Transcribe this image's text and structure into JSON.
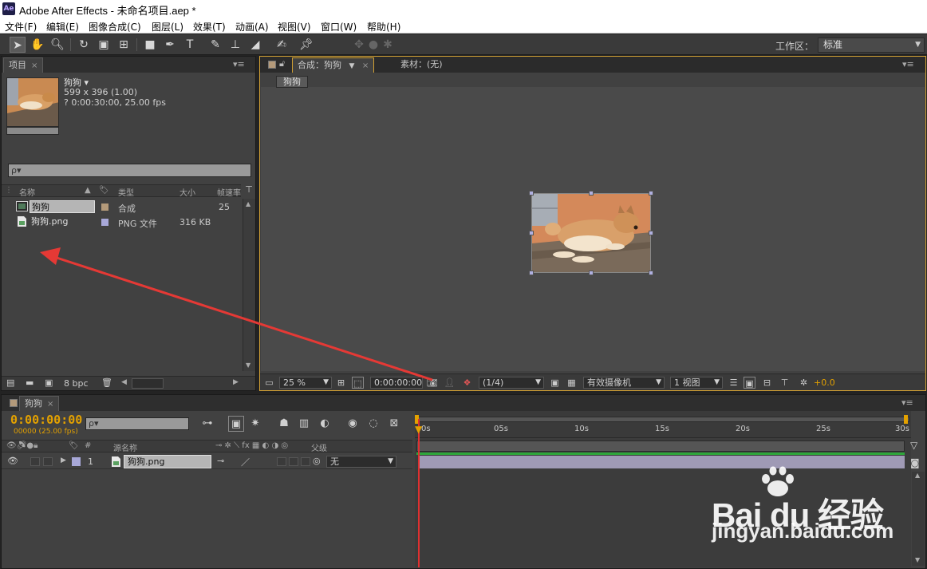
{
  "app": {
    "title": "Adobe After Effects - 未命名项目.aep *",
    "logo": "Ae"
  },
  "menu": [
    "文件(F)",
    "编辑(E)",
    "图像合成(C)",
    "图层(L)",
    "效果(T)",
    "动画(A)",
    "视图(V)",
    "窗口(W)",
    "帮助(H)"
  ],
  "toolbar": {
    "workspace_label": "工作区：",
    "workspace_value": "标准",
    "tools": [
      "selection-tool-icon",
      "hand-tool-icon",
      "zoom-tool-icon",
      "rotate-tool-icon",
      "camera-tool-icon",
      "pan-behind-icon",
      "rectangle-tool-icon",
      "pen-tool-icon",
      "text-tool-icon",
      "brush-tool-icon",
      "clone-stamp-icon",
      "eraser-icon",
      "roto-brush-icon",
      "puppet-pin-icon"
    ]
  },
  "project": {
    "tab_label": "项目",
    "item_name": "狗狗 ▾",
    "dimensions": "599 x 396 (1.00)",
    "duration": "? 0:00:30:00, 25.00 fps",
    "search_placeholder": "ρ▾",
    "columns": {
      "name": "名称",
      "type": "类型",
      "size": "大小",
      "rate": "帧速率"
    },
    "items": [
      {
        "name": "狗狗",
        "type": "合成",
        "size": "",
        "rate": "25",
        "label_color": "#b49a7a"
      },
      {
        "name": "狗狗.png",
        "type": "PNG 文件",
        "size": "316 KB",
        "rate": "",
        "label_color": "#a8a8d8"
      }
    ],
    "bpc": "8 bpc"
  },
  "comp": {
    "tab_label": "合成：狗狗",
    "footage_tab": "素材：(无)",
    "breadcrumb": "狗狗",
    "zoom": "25 %",
    "timecode": "0:00:00:00",
    "resolution": "(1/4)",
    "camera": "有效摄像机",
    "views": "1 视图",
    "exposure": "+0.0"
  },
  "timeline": {
    "tab_label": "狗狗",
    "current_time": "0:00:00:00",
    "frames": "00000 (25.00 fps)",
    "search_placeholder": "ρ▾",
    "col_source": "源名称",
    "col_parent": "父级",
    "layer": {
      "index": "1",
      "name": "狗狗.png",
      "parent": "无",
      "label_color": "#a8a8d8"
    },
    "ticks": [
      "0s",
      "05s",
      "10s",
      "15s",
      "20s",
      "25s",
      "30s"
    ]
  },
  "watermark": {
    "brand": "Bai du 经验",
    "url": "jingyan.baidu.com"
  },
  "colors": {
    "accent": "#e3a100",
    "arrow": "#e53935",
    "active_border": "#d1a033"
  }
}
